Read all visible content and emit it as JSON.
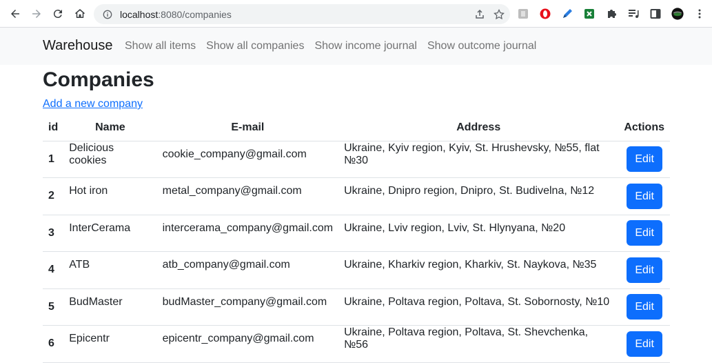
{
  "browser": {
    "url_host": "localhost",
    "url_port": ":8080",
    "url_path": "/companies"
  },
  "navbar": {
    "brand": "Warehouse",
    "links": [
      "Show all items",
      "Show all companies",
      "Show income journal",
      "Show outcome journal"
    ]
  },
  "page": {
    "title": "Companies",
    "add_link": "Add a new company"
  },
  "table": {
    "headers": [
      "id",
      "Name",
      "E-mail",
      "Address",
      "Actions"
    ],
    "rows": [
      {
        "id": "1",
        "name": "Delicious cookies",
        "email": "cookie_company@gmail.com",
        "address": "Ukraine, Kyiv region, Kyiv, St. Hrushevsky, №55, flat №30",
        "action": "Edit"
      },
      {
        "id": "2",
        "name": "Hot iron",
        "email": "metal_company@gmail.com",
        "address": "Ukraine, Dnipro region, Dnipro, St. Budivelna, №12",
        "action": "Edit"
      },
      {
        "id": "3",
        "name": "InterCerama",
        "email": "intercerama_company@gmail.com",
        "address": "Ukraine, Lviv region, Lviv, St. Hlynyana, №20",
        "action": "Edit"
      },
      {
        "id": "4",
        "name": "ATB",
        "email": "atb_company@gmail.com",
        "address": "Ukraine, Kharkiv region, Kharkiv, St. Naykova, №35",
        "action": "Edit"
      },
      {
        "id": "5",
        "name": "BudMaster",
        "email": "budMaster_company@gmail.com",
        "address": "Ukraine, Poltava region, Poltava, St. Sobornosty, №10",
        "action": "Edit"
      },
      {
        "id": "6",
        "name": "Epicentr",
        "email": "epicentr_company@gmail.com",
        "address": "Ukraine, Poltava region, Poltava, St. Shevchenka, №56",
        "action": "Edit"
      }
    ]
  },
  "colors": {
    "primary": "#0d6efd",
    "navbar_bg": "#f8f9fa"
  }
}
